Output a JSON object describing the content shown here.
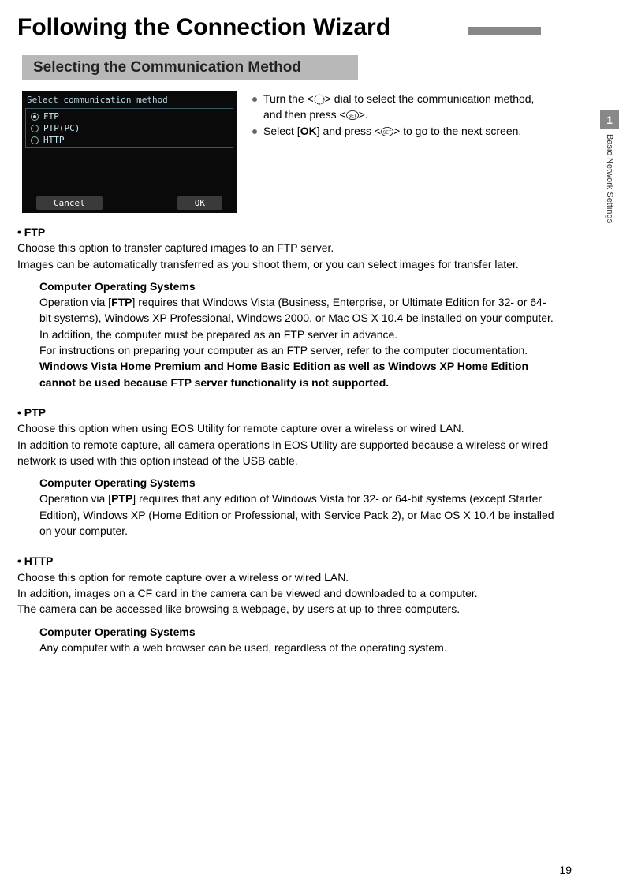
{
  "title": "Following the Connection Wizard",
  "sectionHeader": "Selecting the Communication Method",
  "sideTab": {
    "num": "1",
    "label": "Basic Network Settings"
  },
  "pageNumber": "19",
  "screenshot": {
    "title": "Select communication method",
    "options": [
      "FTP",
      "PTP(PC)",
      "HTTP"
    ],
    "selected": "FTP",
    "cancel": "Cancel",
    "ok": "OK"
  },
  "instructions": {
    "line1a": "Turn the <",
    "line1b": "> dial to select the communication method, and then press <",
    "line1c": ">.",
    "line2a": "Select [",
    "line2b": "OK",
    "line2c": "] and press <",
    "line2d": "> to go to the next screen."
  },
  "ftp": {
    "heading": "• FTP",
    "p1": "Choose this option to transfer captured images to an FTP server.",
    "p2": "Images can be automatically transferred as you shoot them, or you can select images for transfer later.",
    "subHeading": "Computer Operating Systems",
    "p3a": "Operation via [",
    "p3b": "FTP",
    "p3c": "] requires that Windows Vista (Business, Enterprise, or Ultimate Edition for 32- or 64-bit systems), Windows XP Professional, Windows 2000, or Mac OS X 10.4 be installed on your computer. In addition, the computer must be prepared as an FTP server in advance.",
    "p4": "For instructions on preparing your computer as an FTP server, refer to the computer documentation.",
    "p5": "Windows Vista Home Premium and Home Basic Edition as well as Windows XP Home Edition cannot be used because FTP server functionality is not supported."
  },
  "ptp": {
    "heading": "• PTP",
    "p1": "Choose this option when using EOS Utility for remote capture over a wireless or wired LAN.",
    "p2": "In addition to remote capture, all camera operations in EOS Utility are supported because a wireless or wired network is used with this option instead of the USB cable.",
    "subHeading": "Computer Operating Systems",
    "p3a": "Operation via [",
    "p3b": "PTP",
    "p3c": "] requires that any edition of Windows Vista for 32- or 64-bit systems (except Starter Edition), Windows XP (Home Edition or Professional, with Service Pack 2), or Mac OS X 10.4 be installed on your computer."
  },
  "http": {
    "heading": "• HTTP",
    "p1": "Choose this option for remote capture over a wireless or wired LAN.",
    "p2": "In addition, images on a CF card in the camera can be viewed and downloaded to a computer.",
    "p3": "The camera can be accessed like browsing a webpage, by users at up to three computers.",
    "subHeading": "Computer Operating Systems",
    "p4": "Any computer with a web browser can be used, regardless of the operating system."
  }
}
